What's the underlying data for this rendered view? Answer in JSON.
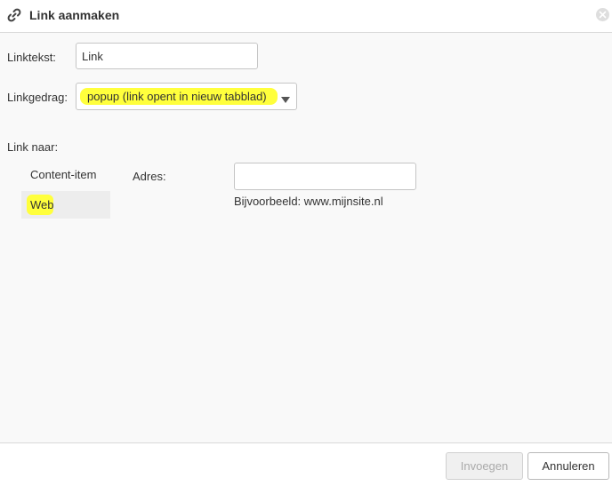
{
  "dialog": {
    "title": "Link aanmaken",
    "icon": "link-icon",
    "close_icon": "close-icon"
  },
  "form": {
    "link_text_label": "Linktekst:",
    "link_text_value": "Link",
    "behavior_label": "Linkgedrag:",
    "behavior_selected": "popup (link opent in nieuw tabblad)",
    "link_to_label": "Link naar:"
  },
  "nav": {
    "items": [
      {
        "label": "Content-item"
      },
      {
        "label": "Web"
      }
    ],
    "active": "Web"
  },
  "web": {
    "address_label": "Adres:",
    "address_value": "",
    "example_text": "Bijvoorbeeld: www.mijnsite.nl"
  },
  "footer": {
    "insert_label": "Invoegen",
    "cancel_label": "Annuleren"
  },
  "colors": {
    "highlight": "#ffff3c",
    "border": "#c5c5c5",
    "background": "#f9f9f9"
  }
}
